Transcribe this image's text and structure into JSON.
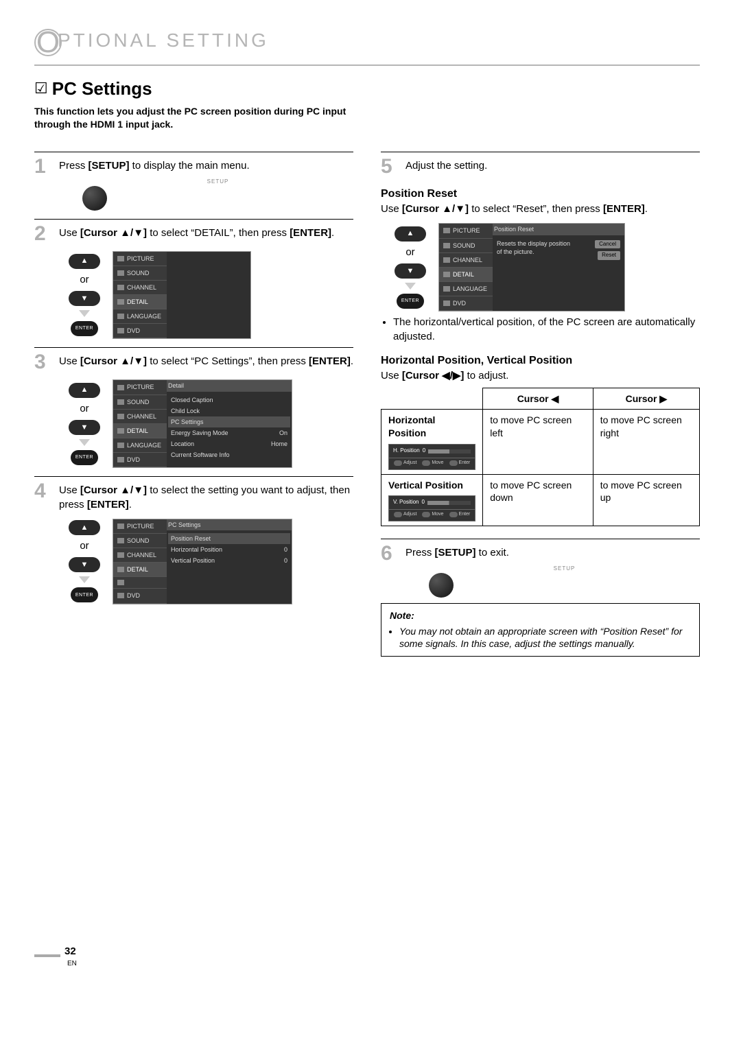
{
  "header": "PTIONAL  SETTING",
  "subtitle": "PC Settings",
  "intro": "This function lets you adjust the PC screen position during PC input through the HDMI 1 input jack.",
  "remote": {
    "setup_label": "SETUP",
    "enter_label": "ENTER",
    "or": "or"
  },
  "steps": {
    "1": {
      "pre": "Press ",
      "btn": "[SETUP]",
      "post": " to display the main menu."
    },
    "2": {
      "pre": "Use ",
      "btn": "[Cursor ▲/▼]",
      "mid": " to select “DETAIL”, then press ",
      "btn2": "[ENTER]",
      "post": "."
    },
    "3": {
      "pre": "Use ",
      "btn": "[Cursor ▲/▼]",
      "mid": " to select “PC Settings”, then press ",
      "btn2": "[ENTER]",
      "post": "."
    },
    "4": {
      "pre": "Use ",
      "btn": "[Cursor ▲/▼]",
      "mid": " to select the setting you want to adjust, then press ",
      "btn2": "[ENTER]",
      "post": "."
    },
    "5": "Adjust the setting.",
    "6": {
      "pre": "Press ",
      "btn": "[SETUP]",
      "post": " to exit."
    }
  },
  "osd_menu": {
    "items": [
      "PICTURE",
      "SOUND",
      "CHANNEL",
      "DETAIL",
      "LANGUAGE",
      "DVD"
    ]
  },
  "osd_detail": {
    "title": "Detail",
    "items": [
      "Closed Caption",
      "Child Lock",
      "PC Settings",
      "Energy Saving Mode",
      "Location",
      "Current Software Info"
    ],
    "vals": {
      "esm": "On",
      "loc": "Home"
    }
  },
  "osd_pcsettings": {
    "title": "PC Settings",
    "items": [
      "Position Reset",
      "Horizontal Position",
      "Vertical Position"
    ],
    "vals": {
      "hp": "0",
      "vp": "0"
    }
  },
  "osd_reset": {
    "title": "Position Reset",
    "msg": "Resets the display position of the picture.",
    "cancel": "Cancel",
    "reset": "Reset"
  },
  "position_reset": {
    "heading": "Position Reset",
    "instr_pre": "Use ",
    "instr_btn": "[Cursor ▲/▼]",
    "instr_mid": " to select “Reset”, then press ",
    "instr_btn2": "[ENTER]",
    "instr_post": ".",
    "bullet": "The horizontal/vertical position, of the PC screen are automatically adjusted."
  },
  "hv_position": {
    "heading": "Horizontal Position, Vertical Position",
    "instr_pre": "Use ",
    "instr_btn": "[Cursor ◀/▶]",
    "instr_post": " to adjust."
  },
  "slider_h": {
    "label": "H. Position",
    "val": "0",
    "adjust": "Adjust",
    "move": "Move",
    "enter": "Enter"
  },
  "slider_v": {
    "label": "V. Position",
    "val": "0",
    "adjust": "Adjust",
    "move": "Move",
    "enter": "Enter"
  },
  "chart_data": {
    "type": "table",
    "columns": [
      "",
      "Cursor ◀",
      "Cursor ▶"
    ],
    "rows": [
      {
        "label": "Horizontal Position",
        "left": "to move PC screen left",
        "right": "to move PC screen right"
      },
      {
        "label": "Vertical Position",
        "left": "to move PC screen down",
        "right": "to move PC screen up"
      }
    ]
  },
  "note": {
    "title": "Note:",
    "item": "You may not obtain an appropriate screen with “Position Reset” for some signals. In this case, adjust the settings manually."
  },
  "page_number": "32",
  "page_footer": "EN"
}
